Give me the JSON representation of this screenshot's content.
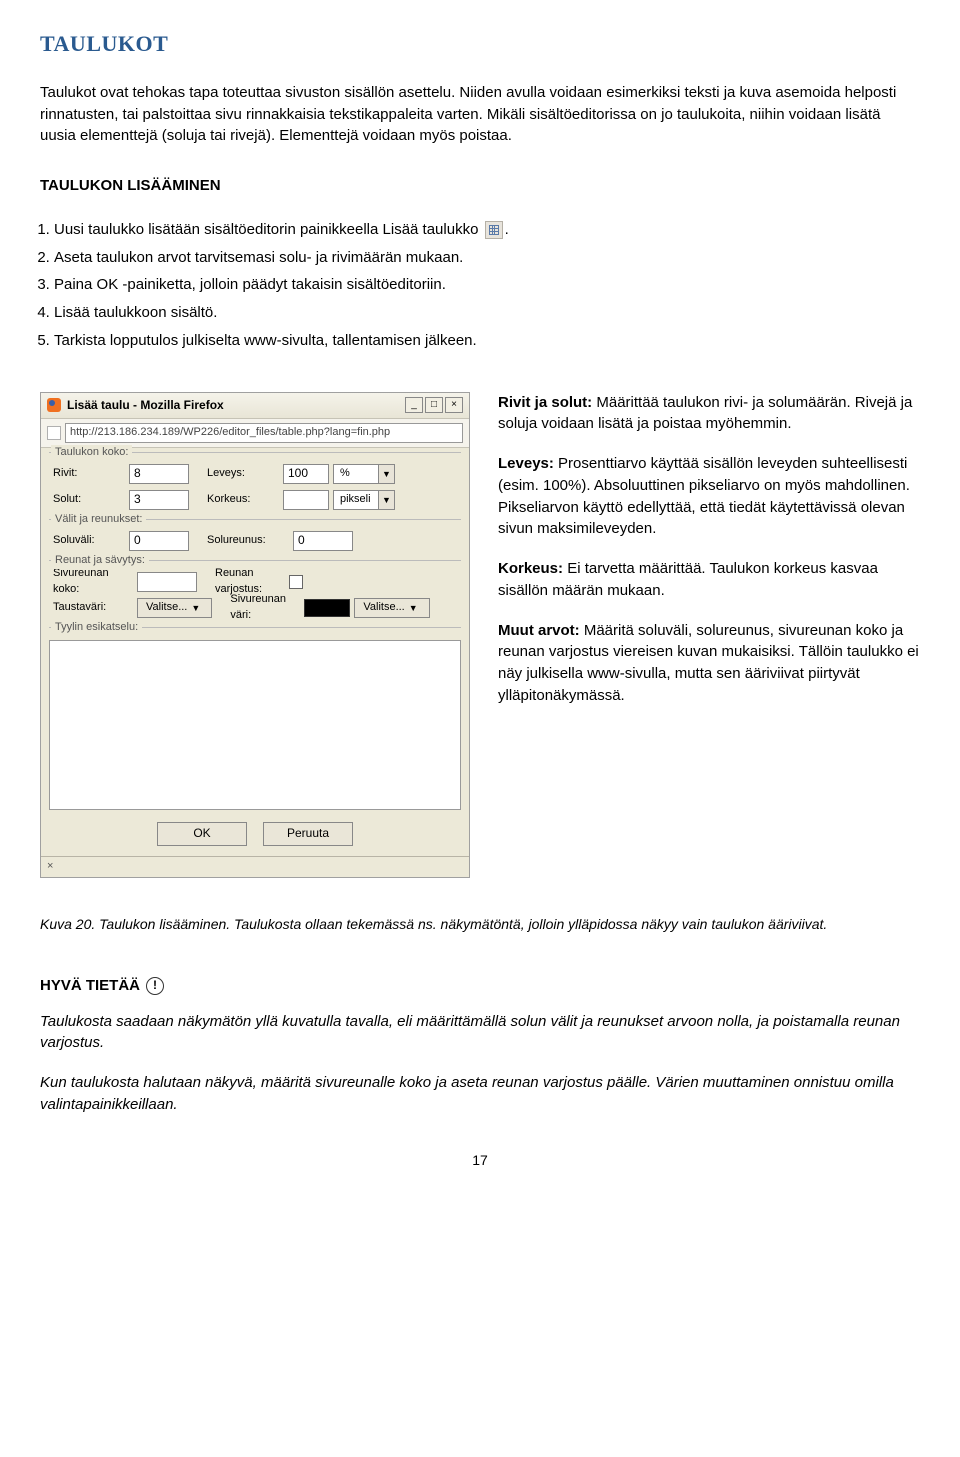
{
  "title": "TAULUKOT",
  "intro": "Taulukot ovat tehokas tapa toteuttaa sivuston sisällön asettelu. Niiden avulla voidaan esimerkiksi teksti ja kuva asemoida helposti rinnatusten, tai palstoittaa sivu rinnakkaisia tekstikappaleita varten. Mikäli sisältöeditorissa on jo taulukoita, niihin voidaan lisätä uusia elementtejä (soluja tai rivejä). Elementtejä voidaan myös poistaa.",
  "section1": "TAULUKON LISÄÄMINEN",
  "steps": {
    "s1a": "Uusi taulukko lisätään sisältöeditorin painikkeella Lisää taulukko",
    "s1b": ".",
    "s2": "Aseta taulukon arvot tarvitsemasi solu- ja rivimäärän mukaan.",
    "s3": "Paina OK -painiketta, jolloin päädyt takaisin sisältöeditoriin.",
    "s4": "Lisää taulukkoon sisältö.",
    "s5": "Tarkista lopputulos julkiselta www-sivulta, tallentamisen jälkeen."
  },
  "dialog": {
    "winTitle": "Lisää taulu - Mozilla Firefox",
    "url": "http://213.186.234.189/WP226/editor_files/table.php?lang=fin.php",
    "groups": {
      "size": "Taulukon koko:",
      "spacing": "Välit ja reunukset:",
      "borders": "Reunat ja sävytys:",
      "preview": "Tyylin esikatselu:"
    },
    "labels": {
      "rows": "Rivit:",
      "cols": "Solut:",
      "width": "Leveys:",
      "height": "Korkeus:",
      "cellspacing": "Soluväli:",
      "cellborder": "Solureunus:",
      "bordersize": "Sivureunan koko:",
      "bordershadow": "Reunan varjostus:",
      "bgcolor": "Taustaväri:",
      "bordercolor": "Sivureunan väri:"
    },
    "values": {
      "rows": "8",
      "cols": "3",
      "width": "100",
      "widthUnit": "%",
      "heightUnit": "pikseli",
      "cellspacing": "0",
      "cellborder": "0",
      "bordersize": "",
      "select": "Valitse..."
    },
    "buttons": {
      "ok": "OK",
      "cancel": "Peruuta"
    },
    "status": "×"
  },
  "desc": {
    "p1b": "Rivit ja solut:",
    "p1": " Määrittää taulukon rivi- ja solumäärän. Rivejä ja soluja voidaan lisätä ja poistaa myöhemmin.",
    "p2b": "Leveys:",
    "p2": " Prosenttiarvo käyttää sisällön leveyden suhteellisesti (esim. 100%). Absoluuttinen pikseliarvo on myös mahdollinen. Pikseliarvon käyttö edellyttää, että tiedät käytettävissä olevan sivun maksimileveyden.",
    "p3b": "Korkeus:",
    "p3": " Ei tarvetta määrittää. Taulukon korkeus kasvaa sisällön määrän mukaan.",
    "p4b": "Muut arvot:",
    "p4": " Määritä soluväli, solureunus, sivureunan koko ja reunan varjostus viereisen kuvan mukaisiksi. Tällöin taulukko ei näy julkisella www-sivulla, mutta sen ääriviivat piirtyvät ylläpitonäkymässä."
  },
  "caption": "Kuva 20. Taulukon lisääminen. Taulukosta ollaan tekemässä ns. näkymätöntä, jolloin ylläpidossa näkyy vain taulukon ääriviivat.",
  "hyva": {
    "title": "HYVÄ TIETÄÄ",
    "p1": "Taulukosta saadaan näkymätön yllä kuvatulla tavalla, eli määrittämällä solun välit ja reunukset arvoon nolla, ja poistamalla reunan varjostus.",
    "p2": "Kun taulukosta halutaan näkyvä, määritä sivureunalle koko ja aseta reunan varjostus päälle. Värien muuttaminen onnistuu omilla valintapainikkeillaan."
  },
  "pageNumber": "17"
}
